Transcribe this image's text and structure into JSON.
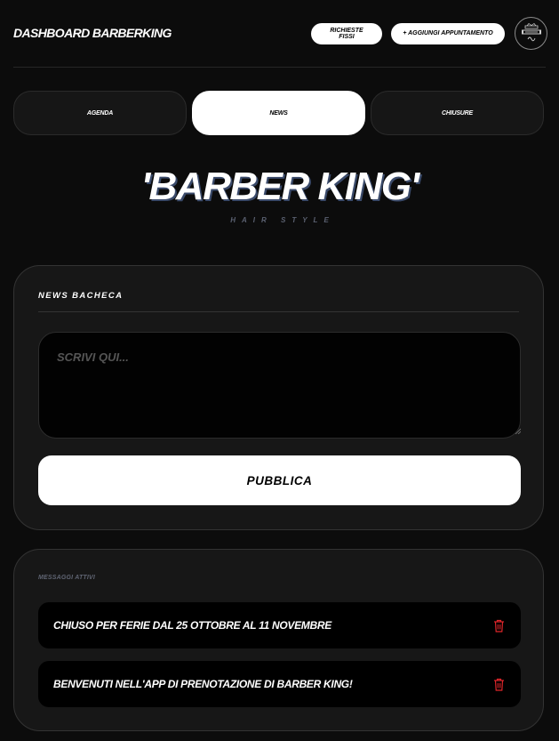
{
  "header": {
    "title": "DASHBOARD BARBERKING",
    "fissi_label": "RICHIESTE FISSI",
    "add_label": "+ AGGIUNGI APPUNTAMENTO",
    "logo_icon": "barber-king-crest-icon"
  },
  "tabs": [
    {
      "label": "AGENDA",
      "active": false
    },
    {
      "label": "NEWS",
      "active": true
    },
    {
      "label": "CHIUSURE",
      "active": false
    }
  ],
  "brand": {
    "title": "'BARBER KING'",
    "subtitle": "HAIR STYLE"
  },
  "news": {
    "heading": "NEWS BACHECA",
    "placeholder": "SCRIVI QUI...",
    "publish_label": "PUBBLICA"
  },
  "messages": {
    "label": "MESSAGGI ATTIVI",
    "items": [
      {
        "text": "CHIUSO PER FERIE DAL 25 OTTOBRE AL 11 NOVEMBRE",
        "icon": "trash-icon"
      },
      {
        "text": "BENVENUTI NELL'APP DI PRENOTAZIONE DI BARBER KING!",
        "icon": "trash-icon"
      }
    ]
  },
  "colors": {
    "background": "#0c0c0c",
    "card": "#171717",
    "accent_delete": "#e0262b"
  }
}
